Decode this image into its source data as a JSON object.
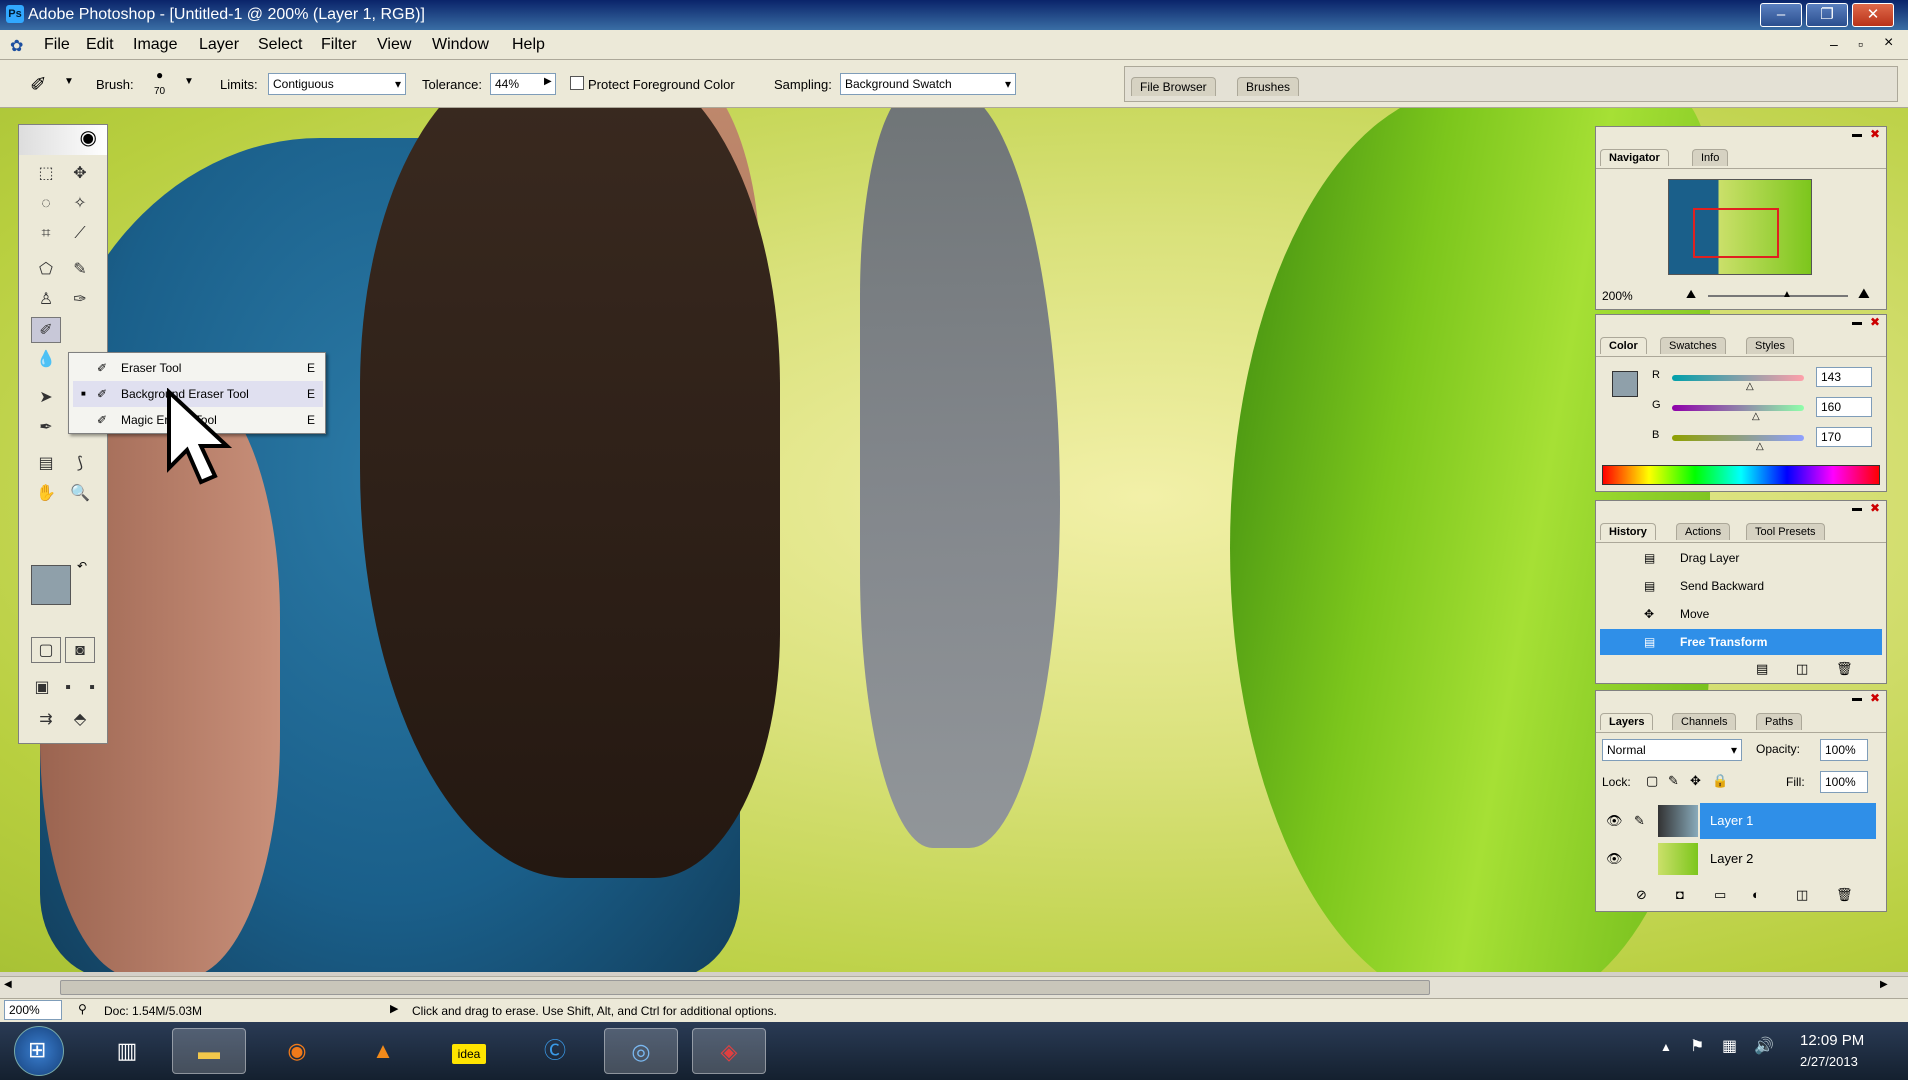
{
  "window": {
    "title": "Adobe Photoshop - [Untitled-1 @ 200% (Layer 1, RGB)]",
    "minimize": "–",
    "restore": "❐",
    "close": "✕"
  },
  "menu": [
    "File",
    "Edit",
    "Image",
    "Layer",
    "Select",
    "Filter",
    "View",
    "Window",
    "Help"
  ],
  "doc_controls": {
    "minimize": "–",
    "restore": "▫",
    "close": "×"
  },
  "options": {
    "brush_label": "Brush:",
    "brush_size": "70",
    "limits_label": "Limits:",
    "limits_value": "Contiguous",
    "tolerance_label": "Tolerance:",
    "tolerance_value": "44%",
    "protect_label": "Protect Foreground Color",
    "sampling_label": "Sampling:",
    "sampling_value": "Background Swatch"
  },
  "palette_well": {
    "tabs": [
      "File Browser",
      "Brushes"
    ]
  },
  "flyout": {
    "items": [
      {
        "label": "Eraser Tool",
        "key": "E"
      },
      {
        "label": "Background Eraser Tool",
        "key": "E"
      },
      {
        "label": "Magic Eraser Tool",
        "key": "E"
      }
    ]
  },
  "navigator": {
    "tabs": [
      "Navigator",
      "Info"
    ],
    "zoom": "200%"
  },
  "color": {
    "tabs": [
      "Color",
      "Swatches",
      "Styles"
    ],
    "r_label": "R",
    "g_label": "G",
    "b_label": "B",
    "r": "143",
    "g": "160",
    "b": "170"
  },
  "history": {
    "tabs": [
      "History",
      "Actions",
      "Tool Presets"
    ],
    "items": [
      "Drag Layer",
      "Send Backward",
      "Move",
      "Free Transform"
    ]
  },
  "layers": {
    "tabs": [
      "Layers",
      "Channels",
      "Paths"
    ],
    "blend_mode": "Normal",
    "opacity_label": "Opacity:",
    "opacity": "100%",
    "lock_label": "Lock:",
    "fill_label": "Fill:",
    "fill": "100%",
    "items": [
      "Layer 1",
      "Layer 2"
    ]
  },
  "status": {
    "zoom": "200%",
    "doc": "Doc: 1.54M/5.03M",
    "hint": "Click and drag to erase. Use Shift, Alt, and Ctrl for additional options."
  },
  "taskbar": {
    "time": "12:09 PM",
    "date": "2/27/2013",
    "idea_label": "idea"
  },
  "colors": {
    "title_bar": "#0a246a",
    "chrome": "#ece9d8",
    "selection": "#2f8fe8"
  }
}
